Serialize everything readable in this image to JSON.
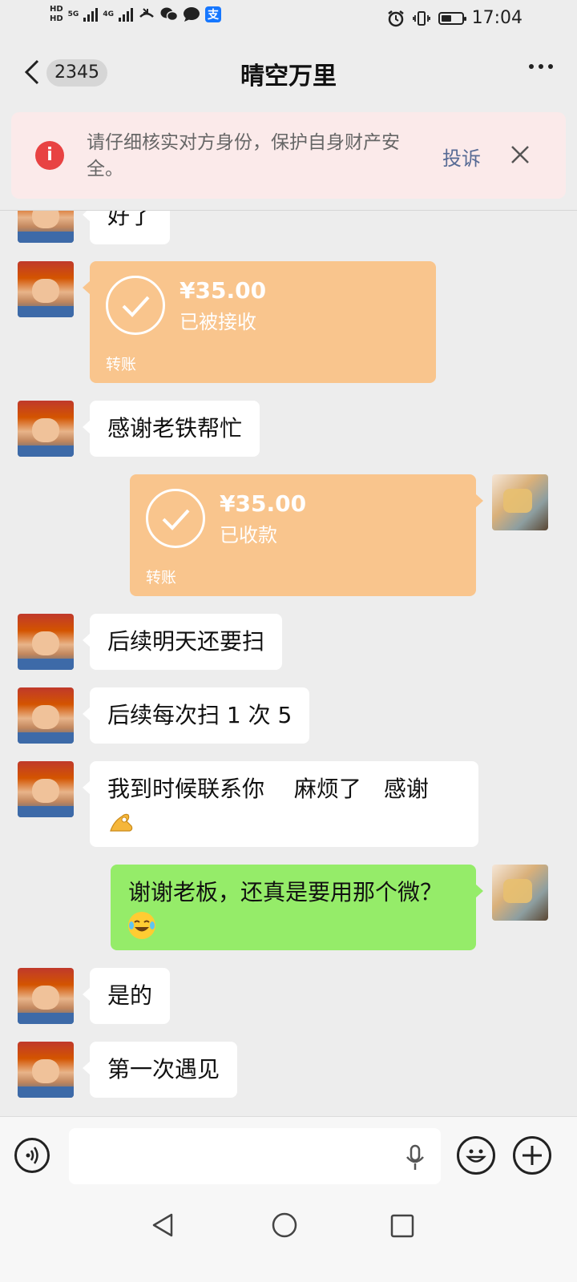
{
  "status_bar": {
    "hd1": "HD",
    "hd2": "HD",
    "sig1": "5G",
    "sig2": "4G",
    "time": "17:04",
    "battery_level": 0.5
  },
  "header": {
    "unread_count": "2345",
    "title": "晴空万里"
  },
  "warning": {
    "text": "请仔细核实对方身份，保护自身财产安全。",
    "complain_label": "投诉"
  },
  "messages": [
    {
      "side": "left",
      "type": "text",
      "text": "好了"
    },
    {
      "side": "left",
      "type": "transfer",
      "amount": "¥35.00",
      "status": "已被接收",
      "label": "转账"
    },
    {
      "side": "left",
      "type": "text",
      "text": "感谢老铁帮忙"
    },
    {
      "side": "right",
      "type": "transfer",
      "amount": "¥35.00",
      "status": "已收款",
      "label": "转账"
    },
    {
      "side": "left",
      "type": "text",
      "text": "后续明天还要扫"
    },
    {
      "side": "left",
      "type": "text",
      "text": "后续每次扫 1 次 5"
    },
    {
      "side": "left",
      "type": "text",
      "text": "我到时候联系你　 麻烦了　感谢",
      "emoji": "ok-hand"
    },
    {
      "side": "right",
      "type": "text",
      "text": "谢谢老板，还真是要用那个微？",
      "emoji": "tears-of-joy"
    },
    {
      "side": "left",
      "type": "text",
      "text": "是的"
    },
    {
      "side": "left",
      "type": "text",
      "text": "第一次遇见"
    }
  ],
  "input": {
    "value": "",
    "placeholder": ""
  }
}
